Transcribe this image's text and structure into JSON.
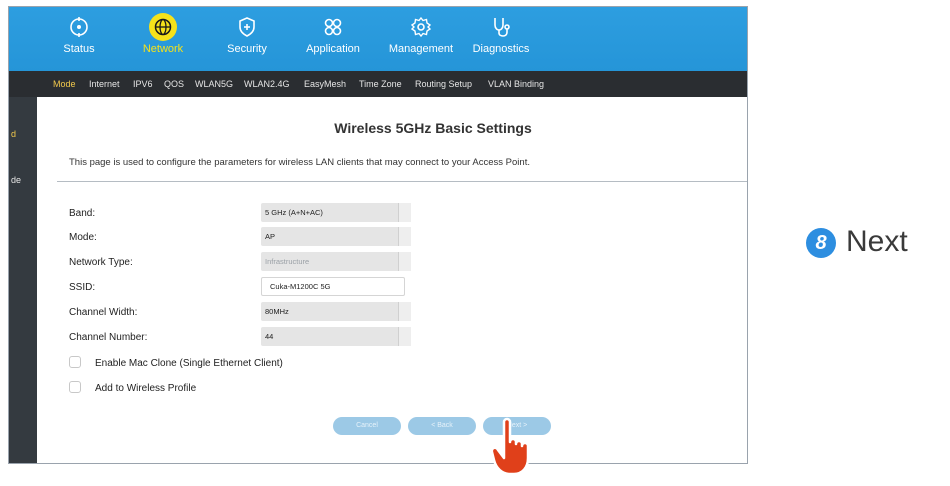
{
  "topnav": {
    "items": [
      {
        "label": "Status",
        "icon": "status-icon"
      },
      {
        "label": "Network",
        "icon": "globe-icon",
        "active": true
      },
      {
        "label": "Security",
        "icon": "shield-icon"
      },
      {
        "label": "Application",
        "icon": "apps-icon"
      },
      {
        "label": "Management",
        "icon": "gear-icon"
      },
      {
        "label": "Diagnostics",
        "icon": "stethoscope-icon"
      }
    ]
  },
  "subnav": {
    "items": [
      {
        "label": "Mode",
        "active": true
      },
      {
        "label": "Internet"
      },
      {
        "label": "IPV6"
      },
      {
        "label": "QOS"
      },
      {
        "label": "WLAN5G"
      },
      {
        "label": "WLAN2.4G"
      },
      {
        "label": "EasyMesh"
      },
      {
        "label": "Time Zone"
      },
      {
        "label": "Routing Setup"
      },
      {
        "label": "VLAN Binding"
      }
    ]
  },
  "sidebar": {
    "fragments": [
      "d",
      "de"
    ]
  },
  "main": {
    "title": "Wireless 5GHz Basic Settings",
    "description": "This page is used to configure the parameters for wireless LAN clients that may connect to your Access Point.",
    "fields": [
      {
        "label": "Band:",
        "value": "5 GHz (A+N+AC)",
        "type": "select"
      },
      {
        "label": "Mode:",
        "value": "AP",
        "type": "select"
      },
      {
        "label": "Network Type:",
        "value": "Infrastructure",
        "type": "select-disabled"
      },
      {
        "label": "SSID:",
        "value": "Cuka-M1200C 5G",
        "type": "text"
      },
      {
        "label": "Channel Width:",
        "value": "80MHz",
        "type": "select"
      },
      {
        "label": "Channel Number:",
        "value": "44",
        "type": "select"
      }
    ],
    "checkboxes": [
      {
        "label": "Enable Mac Clone (Single Ethernet Client)",
        "checked": false
      },
      {
        "label": "Add to Wireless Profile",
        "checked": false
      }
    ],
    "buttons": {
      "cancel": "Cancel",
      "back": "< Back",
      "next": "Next >"
    }
  },
  "annotation": {
    "step_number": "8",
    "step_text": "Next",
    "badge_color": "#2d8ee0"
  },
  "colors": {
    "nav_blue": "#2595d8",
    "active_yellow": "#f5e21a",
    "subnav_dark": "#2a2d31",
    "button_blue": "#9cc9e6",
    "hand_red": "#e0401a"
  }
}
